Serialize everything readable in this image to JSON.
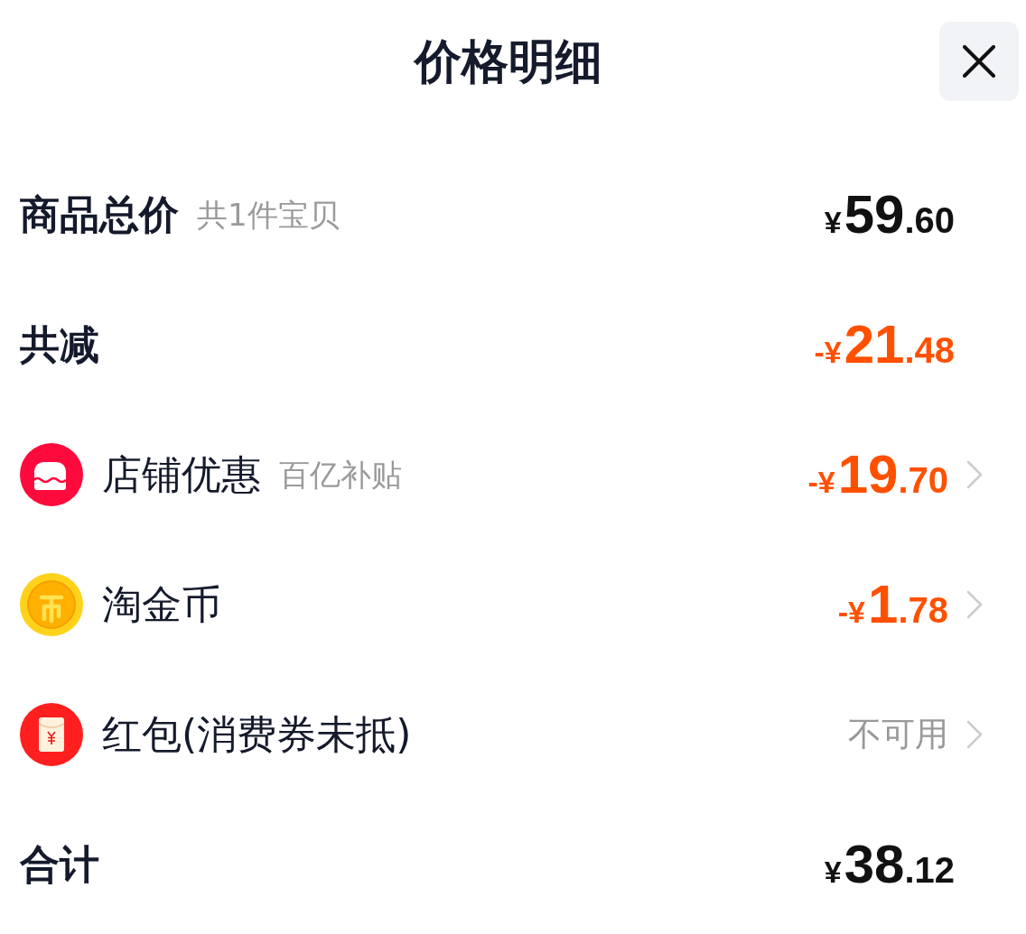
{
  "header": {
    "title": "价格明细"
  },
  "rows": [
    {
      "kind": "summary",
      "label": "商品总价",
      "note": "共1件宝贝",
      "value": {
        "kind": "price",
        "sign": "¥",
        "whole": "59",
        "fraction": ".60",
        "highlight": false
      },
      "chevron": false
    },
    {
      "kind": "summary",
      "label": "共减",
      "value": {
        "kind": "price",
        "sign": "-¥",
        "whole": "21",
        "fraction": ".48",
        "highlight": true
      },
      "chevron": false
    },
    {
      "kind": "store",
      "label": "店铺优惠",
      "note": "百亿补贴",
      "value": {
        "kind": "price",
        "sign": "-¥",
        "whole": "19",
        "fraction": ".70",
        "highlight": true
      },
      "chevron": true
    },
    {
      "kind": "coin",
      "label": "淘金币",
      "value": {
        "kind": "price",
        "sign": "-¥",
        "whole": "1",
        "fraction": ".78",
        "highlight": true
      },
      "chevron": true
    },
    {
      "kind": "envelope",
      "label": "红包(消费券未抵)",
      "value": {
        "kind": "status",
        "text": "不可用"
      },
      "chevron": true
    },
    {
      "kind": "summary",
      "label": "合计",
      "value": {
        "kind": "price",
        "sign": "¥",
        "whole": "38",
        "fraction": ".12",
        "highlight": false
      },
      "chevron": false
    }
  ]
}
